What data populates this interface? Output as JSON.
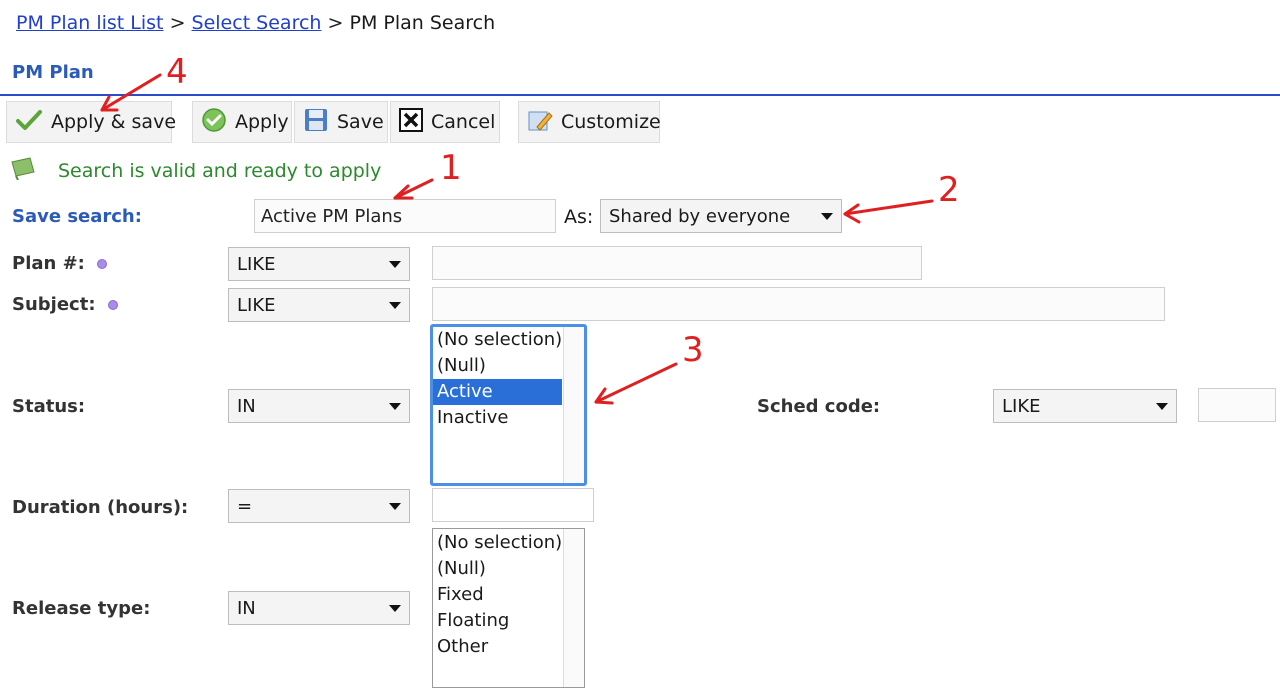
{
  "breadcrumb": {
    "items": [
      "PM Plan list List",
      "Select Search"
    ],
    "separator": ">",
    "current": "PM Plan Search"
  },
  "section_title": "PM Plan",
  "toolbar": {
    "apply_save": "Apply & save",
    "apply": "Apply",
    "save": "Save",
    "cancel": "Cancel",
    "customize": "Customize"
  },
  "status_message": "Search is valid and ready to apply",
  "save_search": {
    "label": "Save search:",
    "value": "Active PM Plans",
    "as_label": "As:",
    "as_value": "Shared by everyone"
  },
  "fields": {
    "plan_no": {
      "label": "Plan #:",
      "operator": "LIKE",
      "value": ""
    },
    "subject": {
      "label": "Subject:",
      "operator": "LIKE",
      "value": ""
    },
    "status": {
      "label": "Status:",
      "operator": "IN",
      "options": [
        "(No selection)",
        "(Null)",
        "Active",
        "Inactive"
      ],
      "selected": "Active"
    },
    "sched_code": {
      "label": "Sched code:",
      "operator": "LIKE",
      "value": ""
    },
    "duration": {
      "label": "Duration (hours):",
      "operator": "=",
      "value": ""
    },
    "release_type": {
      "label": "Release type:",
      "operator": "IN",
      "options": [
        "(No selection)",
        "(Null)",
        "Fixed",
        "Floating",
        "Other"
      ]
    }
  },
  "annotations": [
    "1",
    "2",
    "3",
    "4"
  ],
  "colors": {
    "link": "#1f3fcc",
    "section_title": "#2c5ab8",
    "success": "#2b8a2b",
    "selection": "#2a6fd8",
    "annotation": "#e02020"
  }
}
